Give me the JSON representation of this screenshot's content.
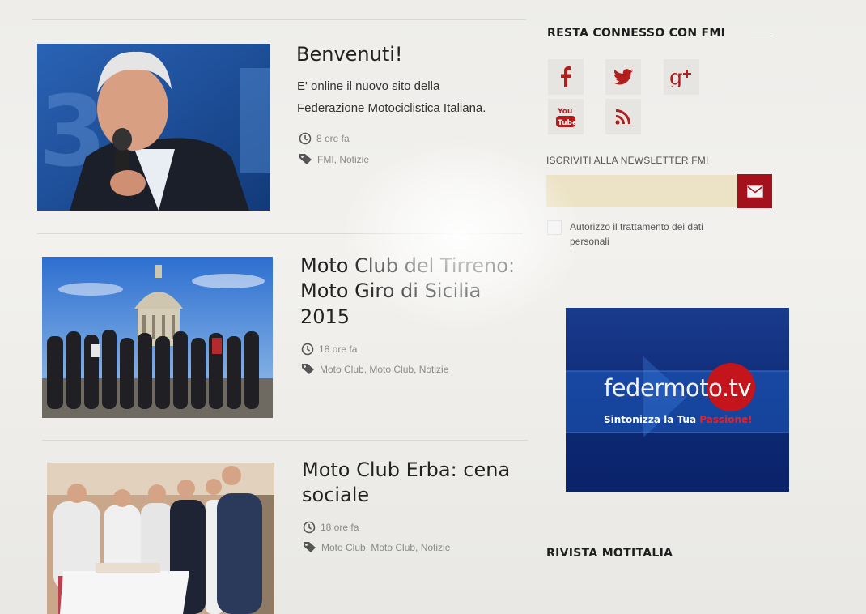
{
  "articles": [
    {
      "title": "Benvenuti!",
      "excerpt_line1": "E' online il nuovo sito della",
      "excerpt_line2": "Federazione Motociclistica Italiana.",
      "time": "8 ore fa",
      "tags": "FMI, Notizie"
    },
    {
      "title_line1": "Moto Club del Tirreno:",
      "title_line2": "Moto Giro di Sicilia",
      "title_line3": "2015",
      "time": "18 ore fa",
      "tags": "Moto Club, Moto Club, Notizie"
    },
    {
      "title_line1": "Moto Club Erba: cena",
      "title_line2": "sociale",
      "time": "18 ore fa",
      "tags": "Moto Club, Moto Club, Notizie"
    }
  ],
  "sidebar": {
    "connect_heading": "RESTA CONNESSO CON FMI",
    "social_icons": [
      "facebook-icon",
      "twitter-icon",
      "google-plus-icon",
      "youtube-icon",
      "rss-icon"
    ],
    "newsletter_label": "ISCRIVITI ALLA NEWSLETTER FMI",
    "newsletter_placeholder": "",
    "consent_label": "Autorizzo il trattamento dei dati personali",
    "tv_brand_main": "federmoto",
    "tv_brand_suffix": ".tv",
    "tv_tagline_white": "Sintonizza la Tua ",
    "tv_tagline_red": "Passione!",
    "magazine_heading": "RIVISTA MOTITALIA"
  },
  "colors": {
    "accent_red": "#a3121c",
    "newsletter_input_bg": "#ece3c6",
    "tv_blue": "#0d2a75"
  }
}
